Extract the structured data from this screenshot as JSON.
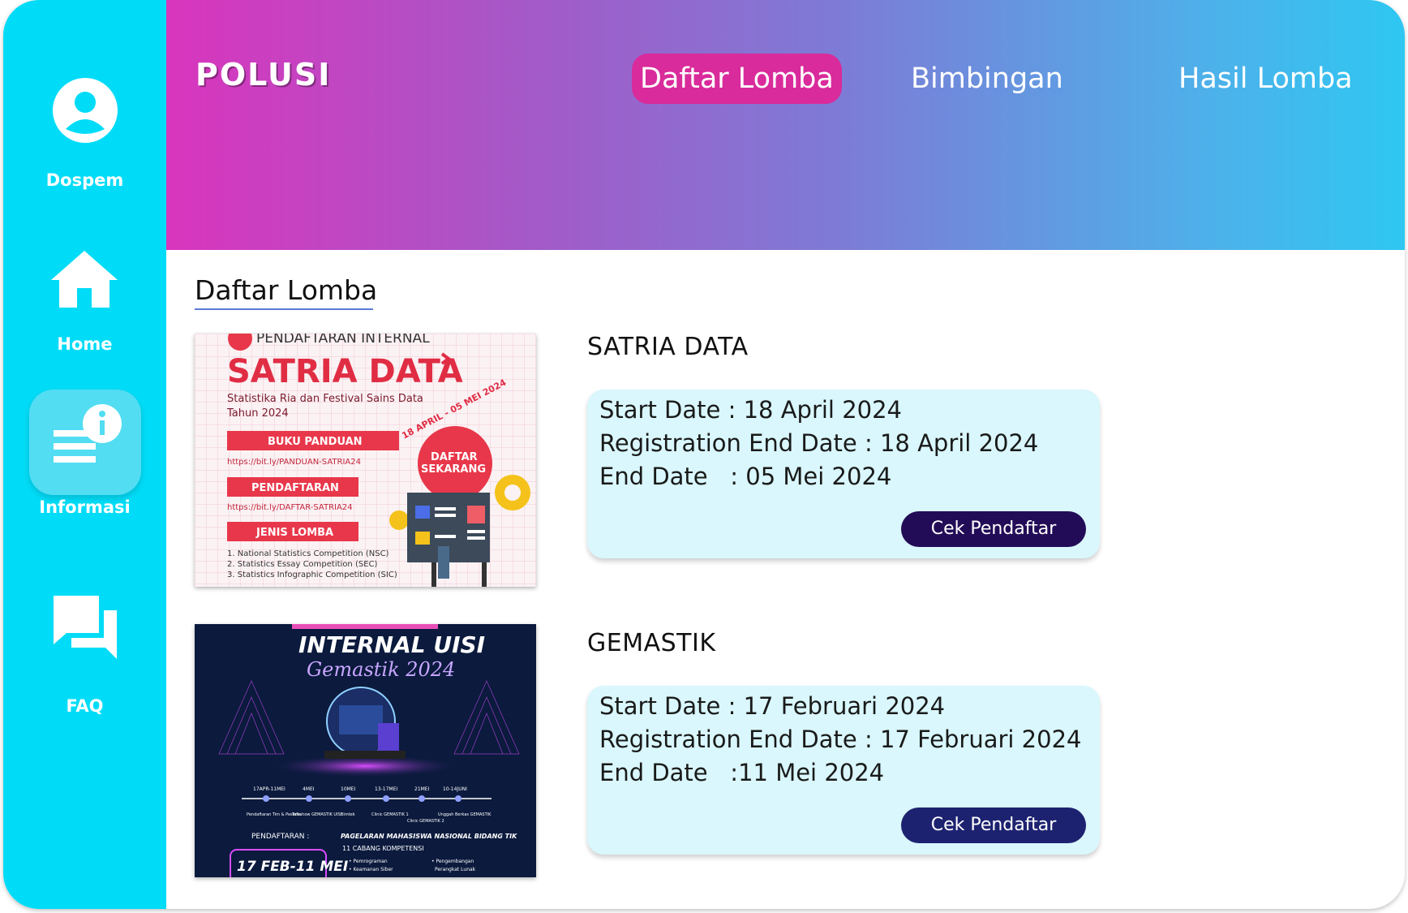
{
  "sidebar": {
    "items": [
      {
        "label": "Dospem",
        "icon": "user-icon"
      },
      {
        "label": "Home",
        "icon": "home-icon"
      },
      {
        "label": "Informasi",
        "icon": "info-list-icon",
        "active": true
      },
      {
        "label": "FAQ",
        "icon": "chat-icon"
      }
    ]
  },
  "header": {
    "logo": "POLUSI",
    "nav": [
      {
        "label": "Daftar Lomba",
        "active": true
      },
      {
        "label": "Bimbingan"
      },
      {
        "label": "Hasil Lomba"
      }
    ]
  },
  "main": {
    "title": "Daftar Lomba",
    "competitions": [
      {
        "name": "SATRIA DATA",
        "start_line": "Start Date : 18 April 2024",
        "reg_end_line": "Registration End Date : 18 April 2024",
        "end_line": "End Date   : 05 Mei 2024",
        "button": "Cek Pendaftar",
        "poster": {
          "header": "PENDAFTARAN INTERNAL",
          "title": "SATRIA DATA",
          "subtitle1": "Statistika Ria dan Festival Sains Data",
          "subtitle2": "Tahun 2024",
          "btn1": "BUKU PANDUAN",
          "link1": "https://bit.ly/PANDUAN-SATRIA24",
          "btn2": "PENDAFTARAN",
          "link2": "https://bit.ly/DAFTAR-SATRIA24",
          "btn3": "JENIS LOMBA",
          "list1": "1. National Statistics Competition (NSC)",
          "list2": "2. Statistics Essay Competition (SEC)",
          "list3": "3. Statistics Infographic Competition (SIC)",
          "date_ribbon": "18 APRIL - 05 MEI 2024",
          "circle1": "DAFTAR",
          "circle2": "SEKARANG"
        }
      },
      {
        "name": "GEMASTIK",
        "start_line": "Start Date : 17 Februari 2024",
        "reg_end_line": "Registration End Date : 17 Februari 2024",
        "end_line": "End Date   :11 Mei 2024",
        "button": "Cek Pendaftar",
        "poster": {
          "title1": "INTERNAL UISI",
          "title2": "Gemastik 2024",
          "timeline_dates": [
            "17APR-11MEI",
            "4MEI",
            "10MEI",
            "13-17MEI",
            "21MEI",
            "10-14JUNI"
          ],
          "timeline_labels": [
            "Pendaftaran Tim & Peserta",
            "Talkshow GEMASTIK UISI",
            "Bimtek",
            "Clinic GEMASTIK 1",
            "Clinic GEMASTIK 2",
            "Unggah Berkas GEMASTIK"
          ],
          "reg_label": "PENDAFTARAN :",
          "reg_dates": "17 FEB-11 MEI",
          "pageant": "PAGELARAN MAHASISWA NASIONAL BIDANG TIK",
          "branches": "11 CABANG KOMPETENSI",
          "list_col1": [
            "• Pemrograman",
            "• Keamanan Siber"
          ],
          "list_col2": [
            "• Pengembangan",
            "Perangkat Lunak"
          ]
        }
      }
    ]
  },
  "colors": {
    "sidebar": "#00dcf7",
    "nav_active": "#d92b9b",
    "button_1": "#230c57",
    "button_2": "#1d2270",
    "card": "#d9f7fc"
  }
}
